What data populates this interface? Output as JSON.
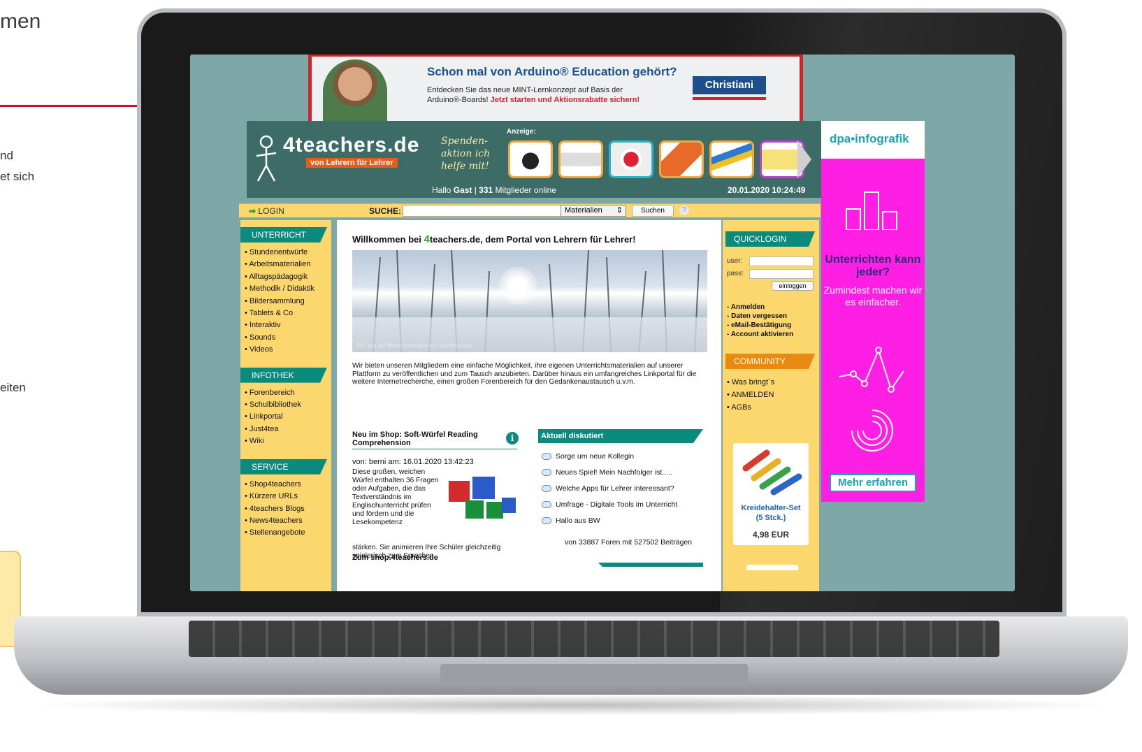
{
  "left_caption": {
    "title": "men",
    "line1": "nd",
    "line2": "et sich",
    "line3": "eiten"
  },
  "banner_ad": {
    "title": "Schon mal von Arduino® Education gehört?",
    "text1": "Entdecken Sie das neue MINT-Lernkonzept auf Basis der",
    "text2_prefix": "Arduino®-Boards! ",
    "text2_cta": "Jetzt starten und Aktionsrabatte sichern!",
    "brand": "Christiani"
  },
  "header": {
    "logo": "4teachers.de",
    "tagline": "von Lehrern für Lehrer",
    "spenden": "Spenden-aktion ich helfe mit!",
    "anzeige_label": "Anzeige:",
    "greeting_prefix": "Hallo ",
    "user": "Gast",
    "members_sep": " | ",
    "members_count": "331",
    "members_suffix": " Mitglieder online",
    "datetime": "20.01.2020 10:24:49"
  },
  "toolbar": {
    "login": "LOGIN",
    "search_label": "SUCHE:",
    "search_value": "",
    "select_value": "Materialien",
    "search_button": "Suchen",
    "help": "?"
  },
  "left_nav": {
    "unterricht": {
      "title": "UNTERRICHT",
      "items": [
        "Stundenentwürfe",
        "Arbeitsmaterialien",
        "Alltagspädagogik",
        "Methodik / Didaktik",
        "Bildersammlung",
        "Tablets & Co",
        "Interaktiv",
        "Sounds",
        "Videos"
      ]
    },
    "infothek": {
      "title": "INFOTHEK",
      "items": [
        "Forenbereich",
        "Schulbibliothek",
        "Linkportal",
        "Just4tea",
        "Wiki"
      ]
    },
    "service": {
      "title": "SERVICE",
      "items": [
        "Shop4teachers",
        "Kürzere URLs",
        "4teachers Blogs",
        "News4teachers",
        "Stellenangebote"
      ]
    }
  },
  "main": {
    "welcome_prefix": "Willkommen bei ",
    "welcome_four": "4",
    "welcome_suffix": "teachers.de, dem Portal von Lehrern für Lehrer!",
    "hero_caption": "Bild aus der Bilderdatenbank von siebenschuh",
    "intro": "Wir bieten unseren Mitgliedern eine einfache Möglichkeit, ihre eigenen Unterrichtsmaterialien auf unserer Plattform zu veröffentlichen und zum Tausch anzubieten. Darüber hinaus ein umfangreiches Linkportal für die weitere Internetrecherche, einen großen Forenbereich für den Gedankenaustausch u.v.m.",
    "shop": {
      "title": "Neu im Shop: Soft-Würfel Reading Comprehension",
      "info": "i",
      "meta": "von: berni am: 16.01.2020 13:42:23",
      "text": "Diese großen, weichen Würfel enthalten 36 Fragen oder Aufgaben, die das Textverständnis im Englischunterricht prüfen und fördern und die Lesekompetenz",
      "text2": "stärken. Sie animieren Ihre Schüler gleichzeitig spielerisch zum Sprechen.",
      "link": "Zum shop.4teachers.de"
    },
    "discussed": {
      "title": "Aktuell diskutiert",
      "items": [
        "Sorge um neue Kollegin",
        "Neues Spiel! Mein Nachfolger ist.....",
        "Welche Apps für Lehrer interessant?",
        "Umfrage - Digitale Tools im Unterricht",
        "Hallo aus BW"
      ],
      "footer": "von 33887 Foren mit 527502 Beiträgen"
    }
  },
  "quicklogin": {
    "title": "QUICKLOGIN",
    "user_label": "user:",
    "pass_label": "pass:",
    "user_value": "",
    "pass_value": "",
    "button": "einloggen",
    "links": [
      "- Anmelden",
      "- Daten vergessen",
      "- eMail-Bestätigung",
      "- Account aktivieren"
    ]
  },
  "community": {
    "title": "COMMUNITY",
    "items": [
      "Was bringt´s",
      "ANMELDEN",
      "AGBs"
    ]
  },
  "product": {
    "name_line1": "Kreidehalter-Set",
    "name_line2": "(5 Stck.)",
    "price": "4,98 EUR"
  },
  "dpa_ad": {
    "brand": "dpa•infografik",
    "headline": "Unterrichten kann jeder?",
    "body": "Zumindest machen wir es einfacher.",
    "button": "Mehr erfahren"
  },
  "colors": {
    "teal": "#0b8a7e",
    "yellow": "#fbd76e",
    "magenta": "#ff1fe4",
    "ad_red": "#d3232a",
    "header_green": "#3d6b66"
  }
}
